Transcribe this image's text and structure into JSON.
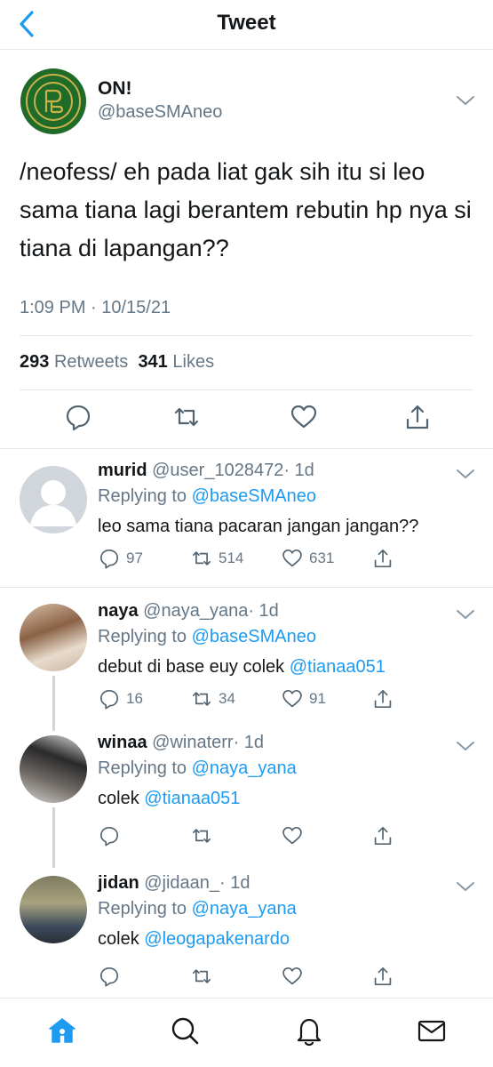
{
  "header": {
    "title": "Tweet"
  },
  "tweet": {
    "name": "ON!",
    "handle": "@baseSMAneo",
    "text": "/neofess/ eh pada liat gak sih itu si leo sama tiana lagi berantem rebutin hp nya si tiana di lapangan??",
    "time": "1:09 PM · 10/15/21",
    "retweets": "293",
    "retweets_label": "Retweets",
    "likes": "341",
    "likes_label": "Likes"
  },
  "replies": [
    {
      "name": "murid",
      "handle": "@user_1028472",
      "age": "· 1d",
      "replying_prefix": "Replying to",
      "replying_to": "@baseSMAneo",
      "text": "leo sama tiana pacaran jangan jangan??",
      "mention": "",
      "comments": "97",
      "retweets": "514",
      "likes": "631"
    },
    {
      "name": "naya",
      "handle": "@naya_yana",
      "age": "· 1d",
      "replying_prefix": "Replying to",
      "replying_to": "@baseSMAneo",
      "text": "debut di base euy colek",
      "mention": "@tianaa051",
      "comments": "16",
      "retweets": "34",
      "likes": "91"
    },
    {
      "name": "winaa",
      "handle": "@winaterr",
      "age": "· 1d",
      "replying_prefix": "Replying to",
      "replying_to": "@naya_yana",
      "text": "colek",
      "mention": "@tianaa051",
      "comments": "",
      "retweets": "",
      "likes": ""
    },
    {
      "name": "jidan",
      "handle": "@jidaan_",
      "age": "· 1d",
      "replying_prefix": "Replying to",
      "replying_to": "@naya_yana",
      "text": "colek",
      "mention": "@leogapakenardo",
      "comments": "",
      "retweets": "",
      "likes": ""
    }
  ],
  "bottom_nav": [
    "home-icon",
    "search-icon",
    "bell-icon",
    "mail-icon"
  ],
  "colors": {
    "accent": "#1d9bf0",
    "text": "#14171a",
    "muted": "#657786",
    "border": "#e1e8ed",
    "logo_green": "#1f6b2a",
    "logo_gold": "#c9b24a"
  }
}
